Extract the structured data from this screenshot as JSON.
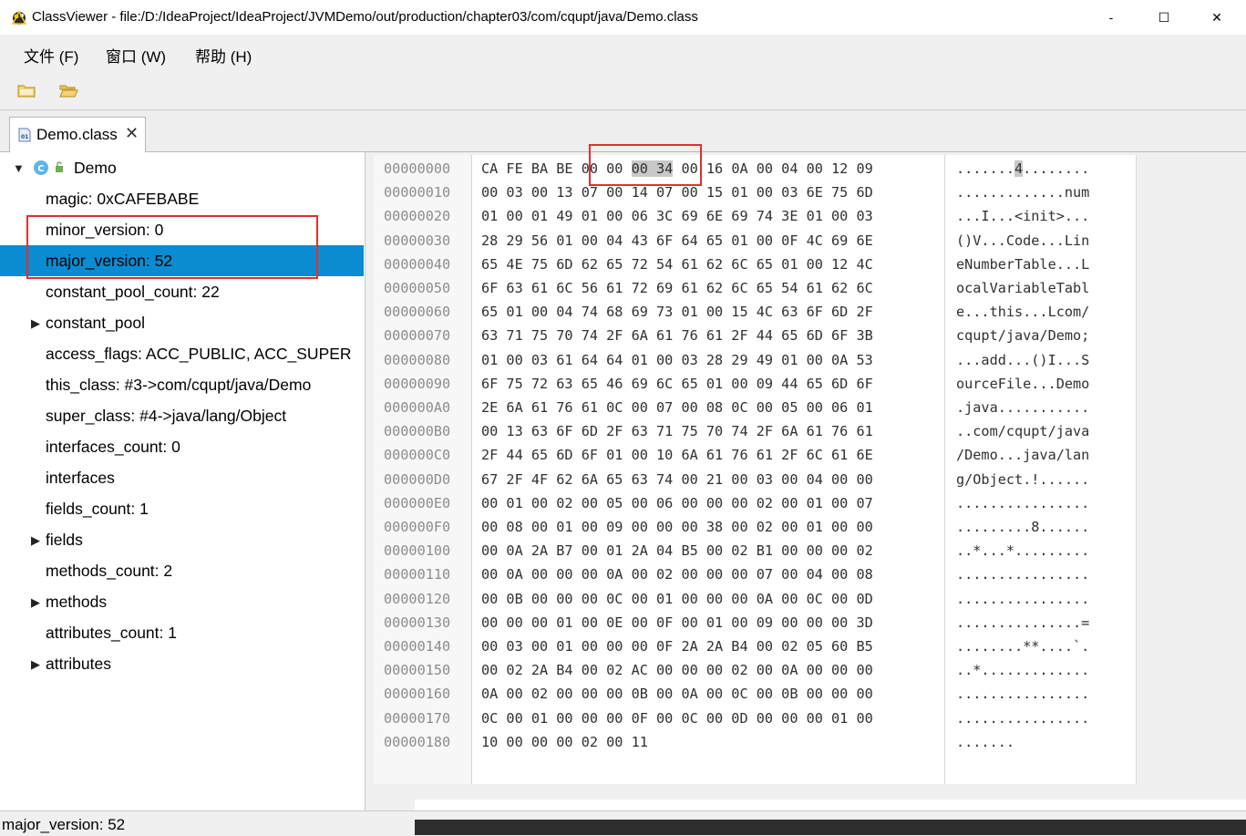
{
  "window": {
    "title": "ClassViewer - file:/D:/IdeaProject/IdeaProject/JVMDemo/out/production/chapter03/com/cqupt/java/Demo.class",
    "minimize": "-",
    "maximize": "☐",
    "close": "✕"
  },
  "menu": [
    {
      "label": "文件 (F)"
    },
    {
      "label": "窗口 (W)"
    },
    {
      "label": "帮助 (H)"
    }
  ],
  "toolbar": {
    "open_icon": "folder-icon",
    "open_file_icon": "open-folder-icon"
  },
  "tab": {
    "label": "Demo.class",
    "close": "✕",
    "icon": "class-file-icon"
  },
  "tree": {
    "root": {
      "label": "Demo",
      "icon": "class-icon"
    },
    "items": [
      {
        "label": "magic: 0xCAFEBABE",
        "expandable": false
      },
      {
        "label": "minor_version: 0",
        "expandable": false
      },
      {
        "label": "major_version: 52",
        "expandable": false,
        "selected": true
      },
      {
        "label": "constant_pool_count: 22",
        "expandable": false
      },
      {
        "label": "constant_pool",
        "expandable": true
      },
      {
        "label": "access_flags: ACC_PUBLIC, ACC_SUPER",
        "expandable": false
      },
      {
        "label": "this_class: #3->com/cqupt/java/Demo",
        "expandable": false
      },
      {
        "label": "super_class: #4->java/lang/Object",
        "expandable": false
      },
      {
        "label": "interfaces_count: 0",
        "expandable": false
      },
      {
        "label": "interfaces",
        "expandable": false
      },
      {
        "label": "fields_count: 1",
        "expandable": false
      },
      {
        "label": "fields",
        "expandable": true
      },
      {
        "label": "methods_count: 2",
        "expandable": false
      },
      {
        "label": "methods",
        "expandable": true
      },
      {
        "label": "attributes_count: 1",
        "expandable": false
      },
      {
        "label": "attributes",
        "expandable": true
      }
    ]
  },
  "hex": {
    "highlight_bytes": "00 34",
    "highlight_ascii": "4",
    "rows": [
      {
        "offset": "00000000",
        "bytes": "CA FE BA BE 00 00 00 34 00 16 0A 00 04 00 12 09",
        "ascii": ".......4........"
      },
      {
        "offset": "00000010",
        "bytes": "00 03 00 13 07 00 14 07 00 15 01 00 03 6E 75 6D",
        "ascii": ".............num"
      },
      {
        "offset": "00000020",
        "bytes": "01 00 01 49 01 00 06 3C 69 6E 69 74 3E 01 00 03",
        "ascii": "...I...<init>..."
      },
      {
        "offset": "00000030",
        "bytes": "28 29 56 01 00 04 43 6F 64 65 01 00 0F 4C 69 6E",
        "ascii": "()V...Code...Lin"
      },
      {
        "offset": "00000040",
        "bytes": "65 4E 75 6D 62 65 72 54 61 62 6C 65 01 00 12 4C",
        "ascii": "eNumberTable...L"
      },
      {
        "offset": "00000050",
        "bytes": "6F 63 61 6C 56 61 72 69 61 62 6C 65 54 61 62 6C",
        "ascii": "ocalVariableTabl"
      },
      {
        "offset": "00000060",
        "bytes": "65 01 00 04 74 68 69 73 01 00 15 4C 63 6F 6D 2F",
        "ascii": "e...this...Lcom/"
      },
      {
        "offset": "00000070",
        "bytes": "63 71 75 70 74 2F 6A 61 76 61 2F 44 65 6D 6F 3B",
        "ascii": "cqupt/java/Demo;"
      },
      {
        "offset": "00000080",
        "bytes": "01 00 03 61 64 64 01 00 03 28 29 49 01 00 0A 53",
        "ascii": "...add...()I...S"
      },
      {
        "offset": "00000090",
        "bytes": "6F 75 72 63 65 46 69 6C 65 01 00 09 44 65 6D 6F",
        "ascii": "ourceFile...Demo"
      },
      {
        "offset": "000000A0",
        "bytes": "2E 6A 61 76 61 0C 00 07 00 08 0C 00 05 00 06 01",
        "ascii": ".java..........."
      },
      {
        "offset": "000000B0",
        "bytes": "00 13 63 6F 6D 2F 63 71 75 70 74 2F 6A 61 76 61",
        "ascii": "..com/cqupt/java"
      },
      {
        "offset": "000000C0",
        "bytes": "2F 44 65 6D 6F 01 00 10 6A 61 76 61 2F 6C 61 6E",
        "ascii": "/Demo...java/lan"
      },
      {
        "offset": "000000D0",
        "bytes": "67 2F 4F 62 6A 65 63 74 00 21 00 03 00 04 00 00",
        "ascii": "g/Object.!......"
      },
      {
        "offset": "000000E0",
        "bytes": "00 01 00 02 00 05 00 06 00 00 00 02 00 01 00 07",
        "ascii": "................"
      },
      {
        "offset": "000000F0",
        "bytes": "00 08 00 01 00 09 00 00 00 38 00 02 00 01 00 00",
        "ascii": ".........8......"
      },
      {
        "offset": "00000100",
        "bytes": "00 0A 2A B7 00 01 2A 04 B5 00 02 B1 00 00 00 02",
        "ascii": "..*...*........."
      },
      {
        "offset": "00000110",
        "bytes": "00 0A 00 00 00 0A 00 02 00 00 00 07 00 04 00 08",
        "ascii": "................"
      },
      {
        "offset": "00000120",
        "bytes": "00 0B 00 00 00 0C 00 01 00 00 00 0A 00 0C 00 0D",
        "ascii": "................"
      },
      {
        "offset": "00000130",
        "bytes": "00 00 00 01 00 0E 00 0F 00 01 00 09 00 00 00 3D",
        "ascii": "...............="
      },
      {
        "offset": "00000140",
        "bytes": "00 03 00 01 00 00 00 0F 2A 2A B4 00 02 05 60 B5",
        "ascii": "........**....`."
      },
      {
        "offset": "00000150",
        "bytes": "00 02 2A B4 00 02 AC 00 00 00 02 00 0A 00 00 00",
        "ascii": "..*............."
      },
      {
        "offset": "00000160",
        "bytes": "0A 00 02 00 00 00 0B 00 0A 00 0C 00 0B 00 00 00",
        "ascii": "................"
      },
      {
        "offset": "00000170",
        "bytes": "0C 00 01 00 00 00 0F 00 0C 00 0D 00 00 00 01 00",
        "ascii": "................"
      },
      {
        "offset": "00000180",
        "bytes": "10 00 00 00 02 00 11",
        "ascii": "......."
      }
    ]
  },
  "status": {
    "text": "major_version: 52"
  },
  "colors": {
    "selection": "#0a8bd2",
    "annotation": "#e03030",
    "hex_highlight": "#c8c8c8"
  }
}
